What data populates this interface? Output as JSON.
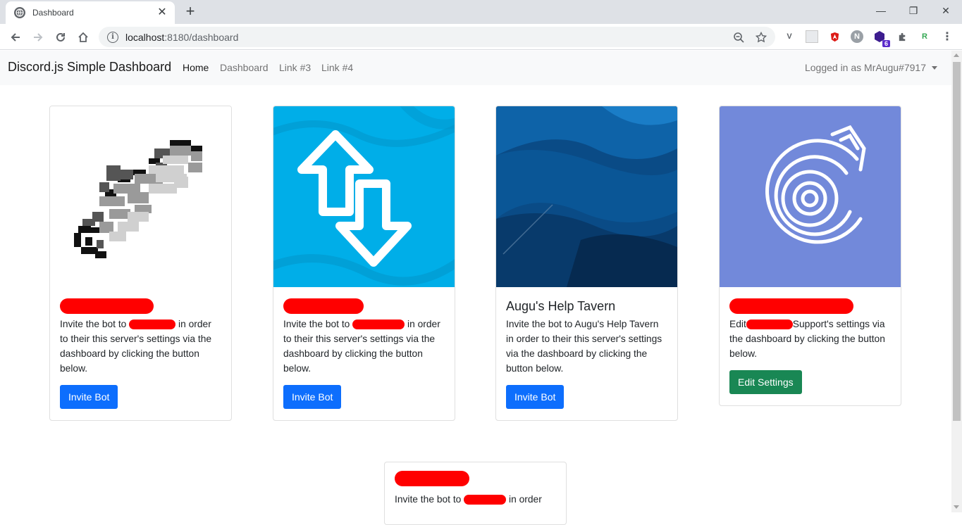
{
  "browser": {
    "tab_title": "Dashboard",
    "tab_close": "✕",
    "new_tab": "+",
    "window_controls": {
      "minimize": "—",
      "restore": "❐",
      "close": "✕"
    },
    "url_host": "localhost",
    "url_path": ":8180/dashboard",
    "extensions": [
      {
        "icon": "vimium-icon",
        "label": "V",
        "color": "#5f6368"
      },
      {
        "icon": "grid-extension-icon",
        "label": "",
        "color": "#c8c8c8"
      },
      {
        "icon": "angular-icon",
        "label": "",
        "color": "#dd1b16"
      },
      {
        "icon": "n-extension-icon",
        "label": "N",
        "color": "#9aa0a6"
      },
      {
        "icon": "badge-extension-icon",
        "label": "6",
        "color": "#5b2bcb"
      },
      {
        "icon": "puzzle-icon",
        "label": "",
        "color": "#5f6368"
      },
      {
        "icon": "r-extension-icon",
        "label": "R",
        "color": "#34a853"
      },
      {
        "icon": "kebab-menu-icon",
        "label": "⋮",
        "color": "#5f6368"
      }
    ]
  },
  "navbar": {
    "brand": "Discord.js Simple Dashboard",
    "links": [
      "Home",
      "Dashboard",
      "Link #3",
      "Link #4"
    ],
    "active_link": "Home",
    "user": "Logged in as MrAugu#7917"
  },
  "colors": {
    "primary": "#0d6efd",
    "success": "#198754",
    "redaction": "#ff0000",
    "card2_bg": "#00aee8",
    "card3_bg": "#0a4b86",
    "card4_bg": "#7289da"
  },
  "cards": [
    {
      "image": "pixel-scroll-image",
      "title_redacted": true,
      "text_before": "Invite the bot to",
      "text_after": "in order to their this server's settings via the dashboard by clicking the button below.",
      "button": "Invite Bot"
    },
    {
      "image": "up-down-arrows-image",
      "title_redacted": true,
      "text_before": "Invite the bot to",
      "text_after": "in order to their this server's settings via the dashboard by clicking the button below.",
      "button": "Invite Bot"
    },
    {
      "image": "blue-waves-image",
      "title": "Augu's Help Tavern",
      "text": "Invite the bot to Augu's Help Tavern in order to their this server's settings via the dashboard by clicking the button below.",
      "button": "Invite Bot"
    },
    {
      "image": "discord-vinyl-image",
      "title_redacted": true,
      "text_before": "Edit",
      "text_after": "Support's settings via the dashboard by clicking the button below.",
      "button": "Edit Settings"
    },
    {
      "title_redacted": true,
      "text_before": "Invite the bot to",
      "text_after": "in order"
    }
  ]
}
